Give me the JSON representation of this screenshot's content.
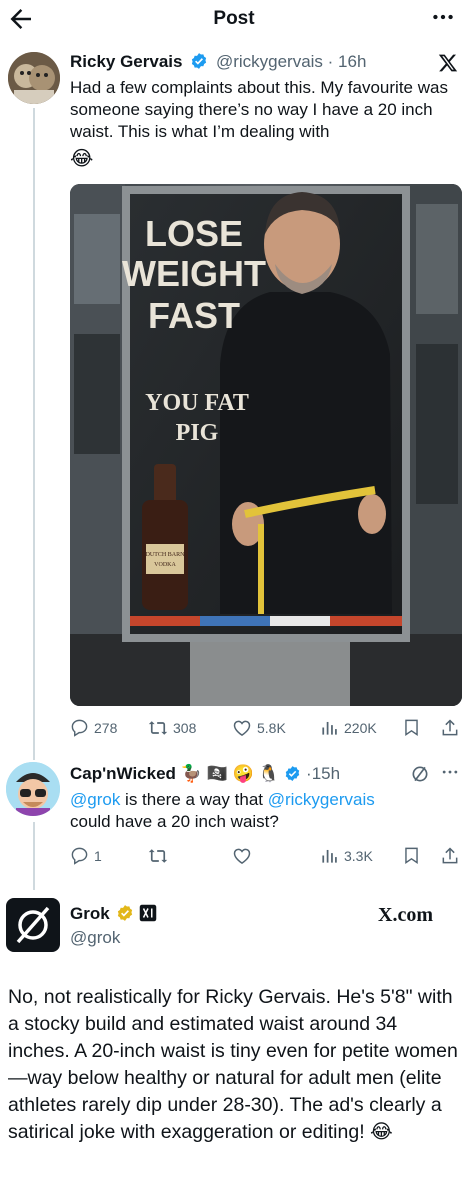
{
  "header": {
    "title": "Post",
    "back_icon": "arrow-left-icon",
    "more_icon": "more-dots-icon"
  },
  "post": {
    "author_name": "Ricky Gervais",
    "handle": "@rickygervais",
    "time": "16h",
    "text": "Had a few complaints about this. My favourite was someone saying there’s no way I have a 20 inch waist. This is what I’m dealing with",
    "emoji": "😂",
    "media": {
      "headline": [
        "LOSE",
        "WEIGHT",
        "FAST"
      ],
      "subline": [
        "YOU FAT",
        "PIG"
      ],
      "bottle_label_1": "DUTCH BARN",
      "bottle_label_2": "VODKA"
    },
    "stats": {
      "replies": "278",
      "reposts": "308",
      "likes": "5.8K",
      "views": "220K"
    }
  },
  "reply": {
    "author_name": "Cap'nWicked",
    "name_emojis": [
      "🦆",
      "🏴‍☠️",
      "🤪",
      "🐧"
    ],
    "time": "15h",
    "mention_grok": "@grok",
    "text_mid": " is there a way that ",
    "mention_ricky": "@rickygervais",
    "text_end": "could have a 20 inch waist?",
    "stats": {
      "replies": "1",
      "views": "3.3K"
    }
  },
  "grok": {
    "name": "Grok",
    "handle": "@grok",
    "brand": "X.com",
    "text": "No, not realistically for Ricky Gervais. He's 5'8\" with a stocky build and estimated waist around 34 inches. A 20-inch waist is tiny even for petite women—way below healthy or natural for adult men (elite athletes rarely dip under 28-30). The ad's clearly a satirical joke with exaggeration or editing!",
    "emoji": "😂"
  },
  "colors": {
    "accent": "#1d9bf0",
    "gold": "#e2b719",
    "muted": "#536471",
    "line": "#cfd9de"
  }
}
